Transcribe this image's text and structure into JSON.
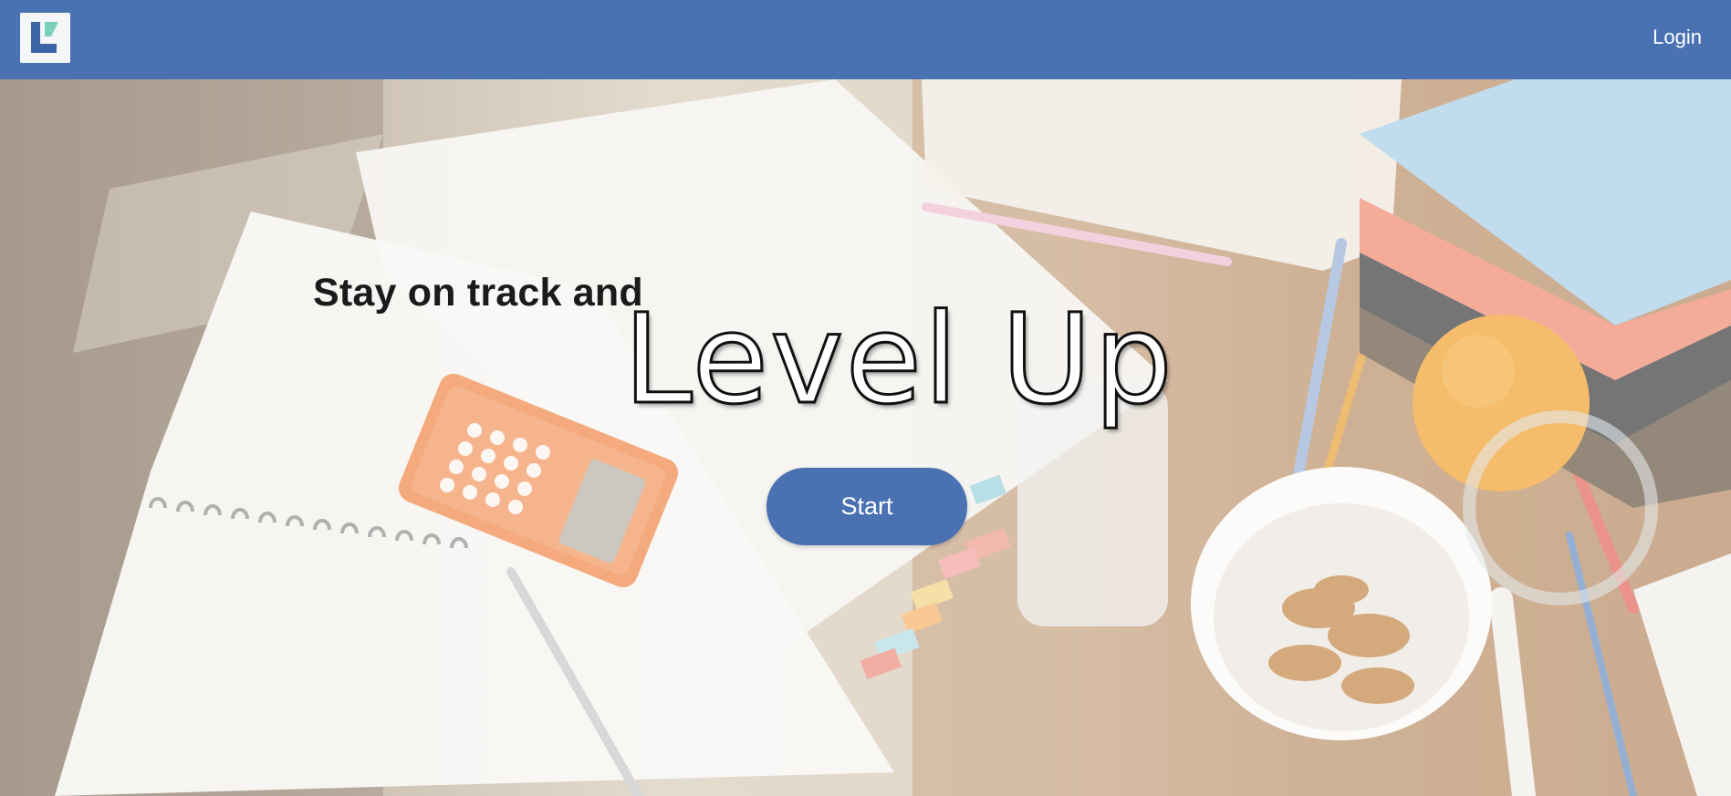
{
  "header": {
    "logo_icon": "level-up-logo-icon",
    "login_label": "Login",
    "bg_color": "#4a72b2"
  },
  "hero": {
    "tagline": "Stay on track and",
    "headline": "Level Up",
    "start_label": "Start",
    "button_color": "#4a72b2"
  }
}
